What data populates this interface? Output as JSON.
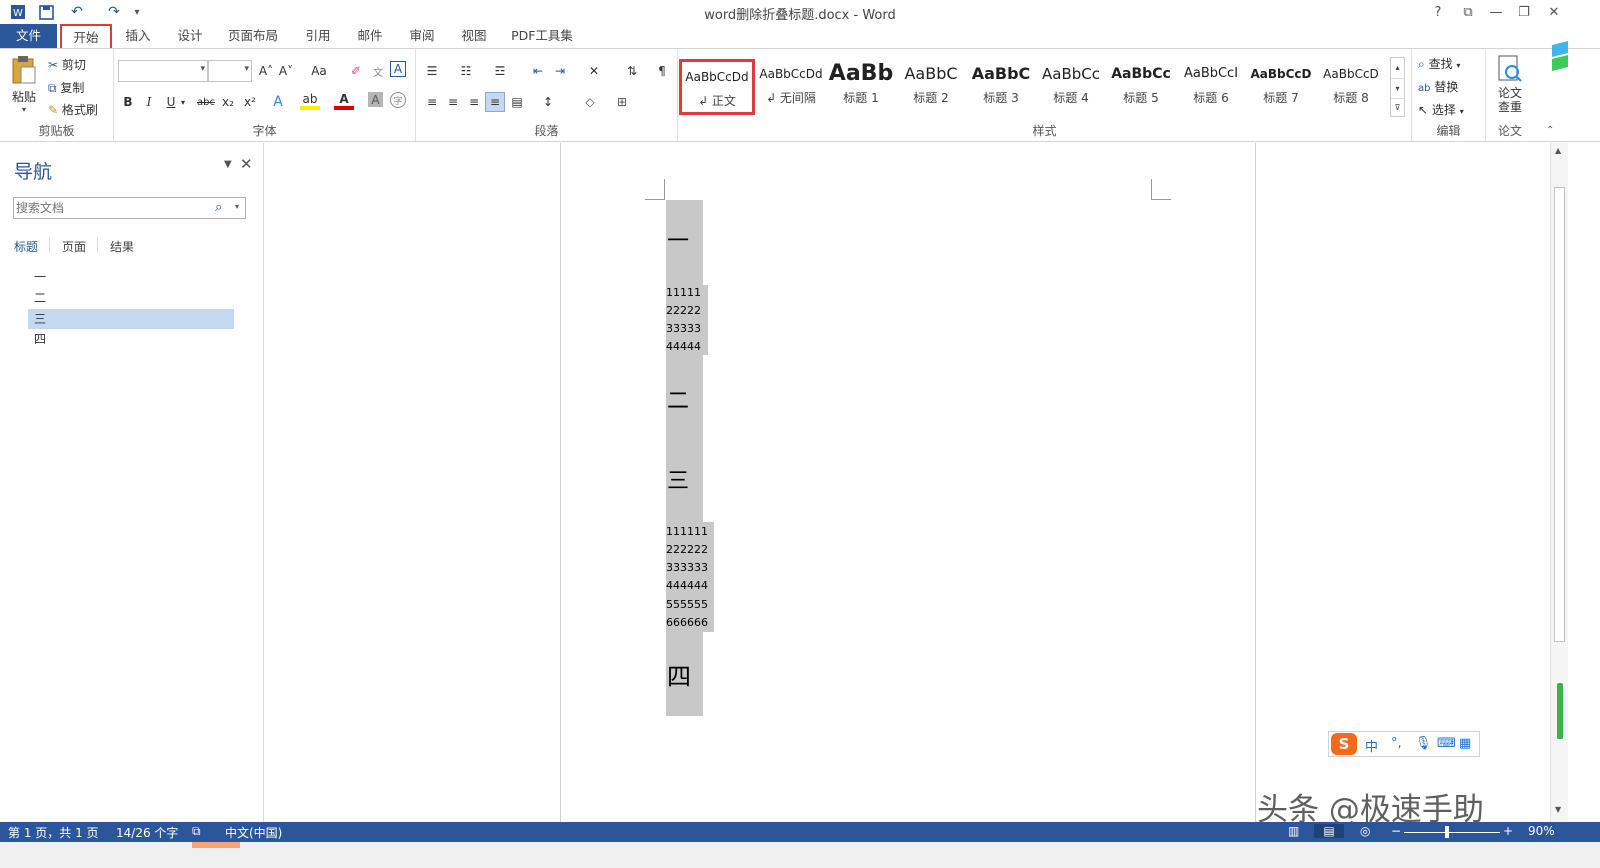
{
  "app": {
    "title": "word删除折叠标题.docx - Word",
    "window_controls": {
      "help": "?",
      "restore_ribbon": "⧉",
      "minimize": "—",
      "maximize": "❐",
      "close": "✕"
    }
  },
  "quick_access": {
    "save_icon": "save-icon",
    "undo_icon": "undo-icon",
    "redo_icon": "redo-icon",
    "customize": "₹"
  },
  "tabs": [
    {
      "label": "文件"
    },
    {
      "label": "开始"
    },
    {
      "label": "插入"
    },
    {
      "label": "设计"
    },
    {
      "label": "页面布局"
    },
    {
      "label": "引用"
    },
    {
      "label": "邮件"
    },
    {
      "label": "审阅"
    },
    {
      "label": "视图"
    },
    {
      "label": "PDF工具集"
    }
  ],
  "ribbon": {
    "clipboard": {
      "paste": "粘贴",
      "cut": "剪切",
      "copy": "复制",
      "format_painter": "格式刷",
      "label": "剪贴板"
    },
    "font": {
      "label": "字体",
      "font_name_value": "",
      "font_size_value": "",
      "grow": "A˄",
      "shrink": "A˅",
      "case": "Aa",
      "bold": "B",
      "italic": "I",
      "underline": "U",
      "strike": "abc",
      "subscript": "x₂",
      "superscript": "x²"
    },
    "paragraph": {
      "label": "段落"
    },
    "styles": {
      "label": "样式",
      "items": [
        {
          "preview": "AaBbCcDd",
          "name": "↲ 正文"
        },
        {
          "preview": "AaBbCcDd",
          "name": "↲ 无间隔"
        },
        {
          "preview": "AaBb",
          "name": "标题 1"
        },
        {
          "preview": "AaBbC",
          "name": "标题 2"
        },
        {
          "preview": "AaBbC",
          "name": "标题 3"
        },
        {
          "preview": "AaBbCc",
          "name": "标题 4"
        },
        {
          "preview": "AaBbCc",
          "name": "标题 5"
        },
        {
          "preview": "AaBbCcI",
          "name": "标题 6"
        },
        {
          "preview": "AaBbCcD",
          "name": "标题 7"
        },
        {
          "preview": "AaBbCcD",
          "name": "标题 8"
        }
      ]
    },
    "editing": {
      "label": "编辑",
      "find": "查找",
      "replace": "替换",
      "select": "选择"
    },
    "thesis": {
      "label": "论文",
      "check_line1": "论文",
      "check_line2": "查重"
    }
  },
  "navigation": {
    "title": "导航",
    "search_placeholder": "搜索文档",
    "tabs": [
      "标题",
      "页面",
      "结果"
    ],
    "headings": [
      "一",
      "二",
      "三",
      "四"
    ],
    "selected_heading_index": 2
  },
  "document": {
    "headings": [
      "一",
      "二",
      "三",
      "四"
    ],
    "block1": [
      "11111",
      "22222",
      "33333",
      "44444"
    ],
    "block3": [
      "111111",
      "222222",
      "333333",
      "444444",
      "555555",
      "666666"
    ]
  },
  "ime": {
    "logo": "S",
    "lang": "中",
    "punct": "°,",
    "mic": "mic-icon",
    "keyboard": "keyboard-icon",
    "apps": "apps-icon"
  },
  "watermark": "头条 @极速手助",
  "status_bar": {
    "page": "第 1 页，共 1 页",
    "words": "14/26 个字",
    "language": "中文(中国)",
    "zoom": "90%"
  }
}
